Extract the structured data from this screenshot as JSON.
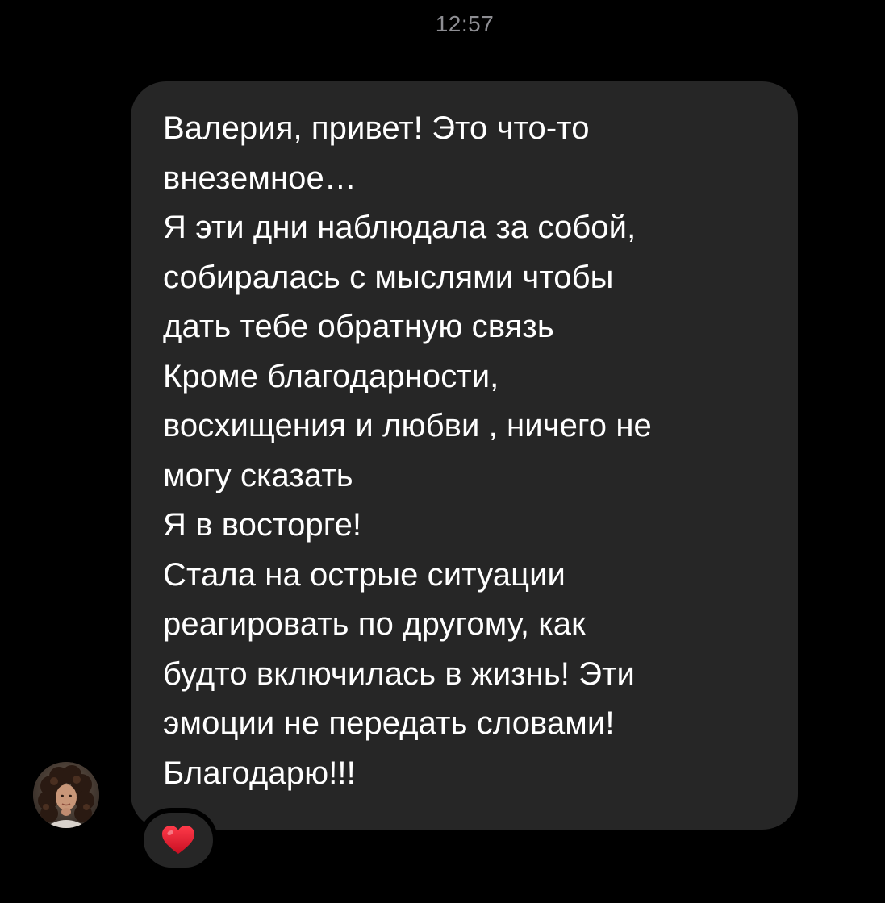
{
  "chat": {
    "timestamp": "12:57",
    "message": {
      "lines": [
        "Валерия, привет! Это что-то",
        "внеземное…",
        "Я эти дни наблюдала за собой,",
        "собиралась с мыслями чтобы",
        "дать тебе обратную связь",
        "Кроме благодарности,",
        "восхищения и любви , ничего не",
        "могу сказать",
        "Я в восторге!",
        "Стала на острые ситуации",
        "реагировать по другому, как",
        "будто включилась в жизнь! Эти",
        "эмоции не передать словами!",
        "Благодарю!!!"
      ]
    },
    "reaction": {
      "icon": "red-heart-icon",
      "color": "#e0142c"
    },
    "sender_avatar": {
      "icon": "sender-avatar-photo"
    }
  },
  "theme": {
    "background": "#000000",
    "bubble": "#262626",
    "text": "#ffffff",
    "timestamp": "#8e8e93"
  }
}
